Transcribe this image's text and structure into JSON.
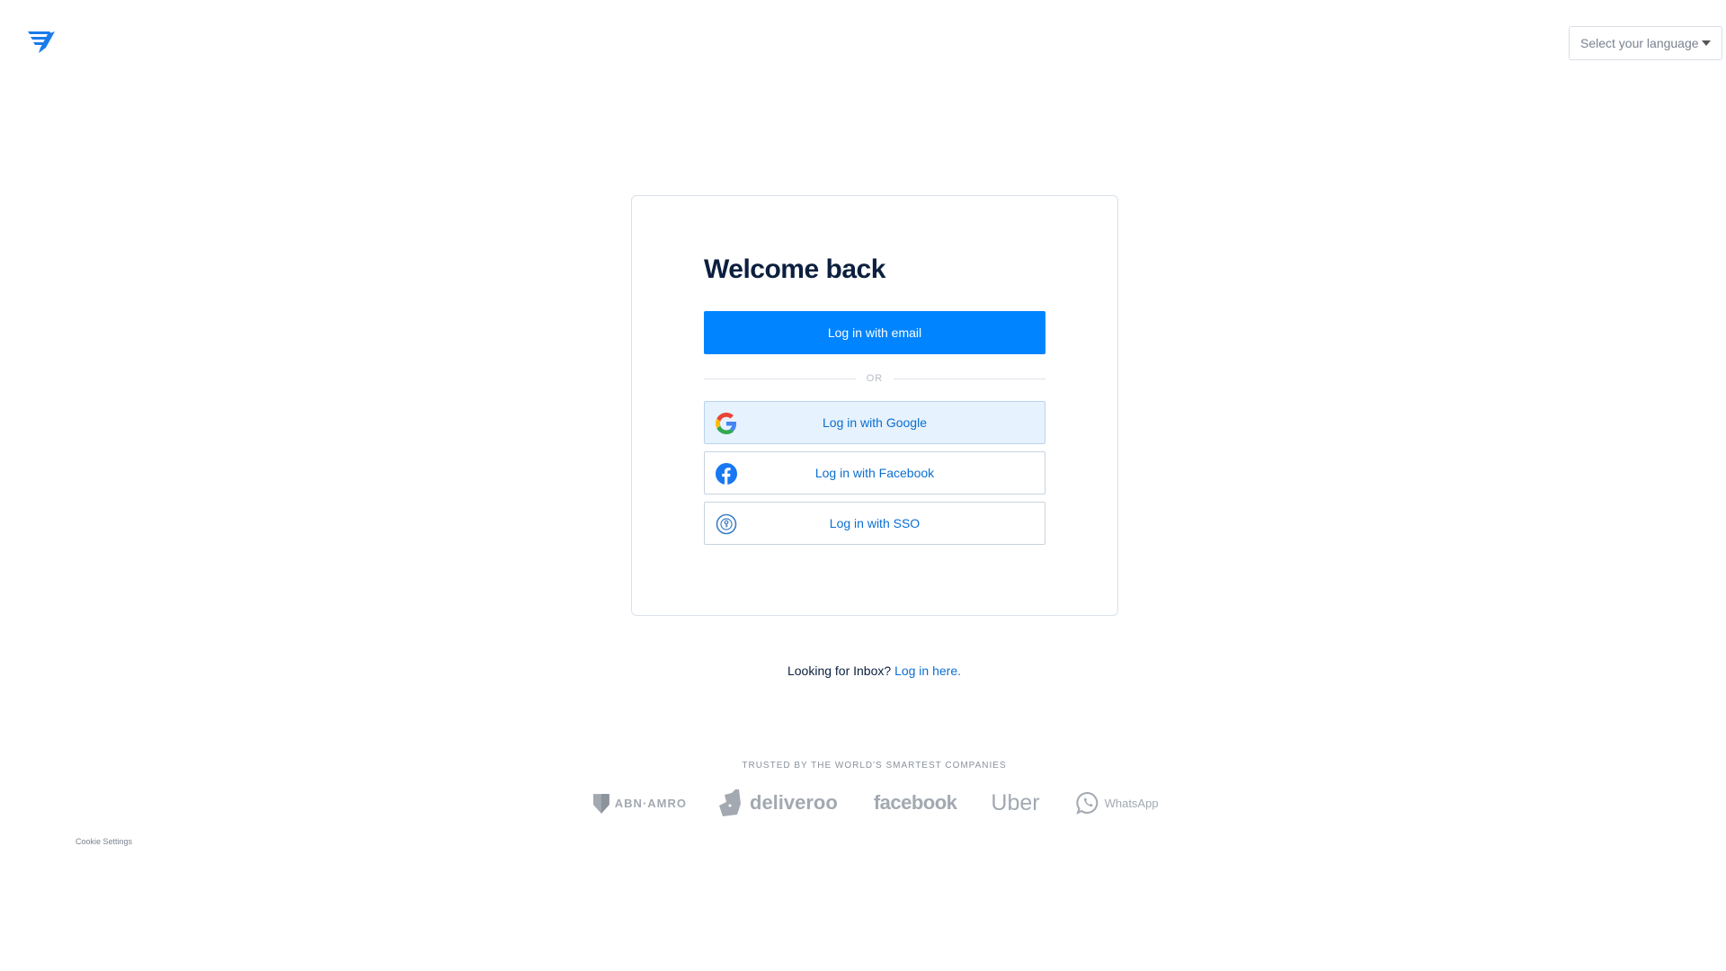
{
  "header": {
    "logo_icon": "messagebird-logo-icon",
    "brand_color": "#1a7bea",
    "language_select": {
      "value": "Select your language"
    }
  },
  "card": {
    "title": "Welcome back",
    "email_button_label": "Log in with email",
    "divider_label": "OR",
    "social": {
      "google_label": "Log in with Google",
      "facebook_label": "Log in with Facebook",
      "sso_label": "Log in with SSO"
    },
    "primary_color": "#0084ff",
    "link_color": "#0a6fd1"
  },
  "inbox": {
    "prompt": "Looking for Inbox?",
    "link_label": "Log in here."
  },
  "trusted": {
    "heading": "TRUSTED BY THE WORLD'S SMARTEST COMPANIES",
    "brands": [
      "ABN·AMRO",
      "deliveroo",
      "facebook",
      "Uber",
      "WhatsApp"
    ]
  },
  "footer": {
    "cookie_settings_label": "Cookie Settings"
  }
}
